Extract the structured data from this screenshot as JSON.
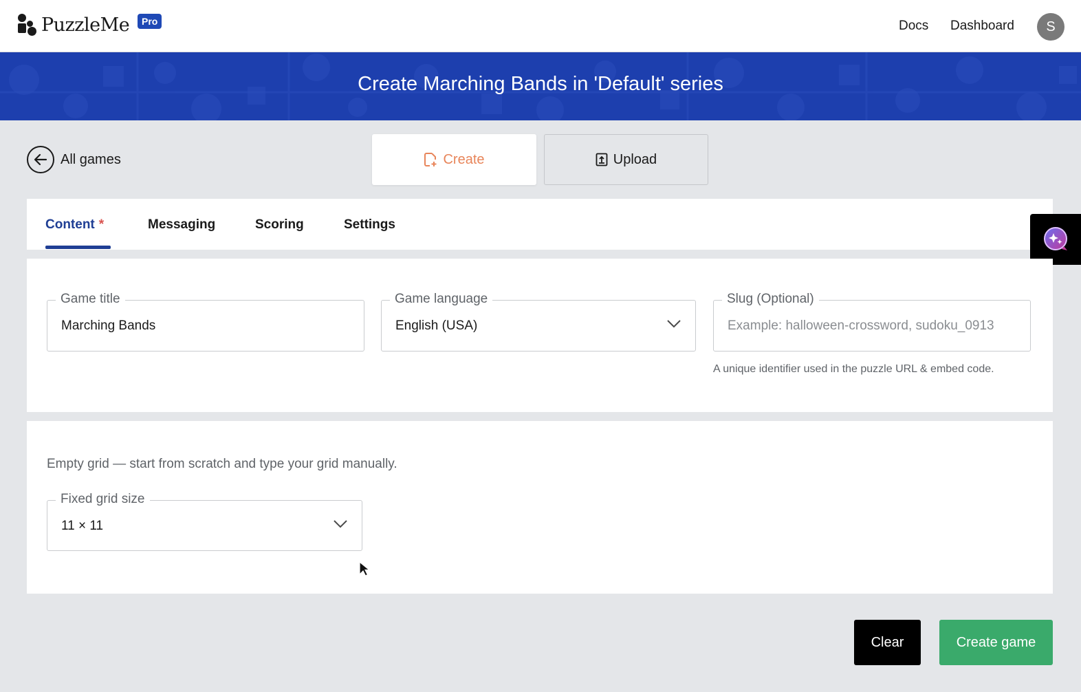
{
  "header": {
    "brand": "PuzzleMe",
    "badge": "Pro",
    "nav": [
      "Docs",
      "Dashboard"
    ],
    "avatar_initial": "S"
  },
  "banner": {
    "title": "Create Marching Bands in 'Default' series",
    "color": "#1d3fae"
  },
  "back": {
    "label": "All games",
    "icon": "arrow-left-icon"
  },
  "mode": {
    "create_label": "Create",
    "upload_label": "Upload",
    "active": "Create"
  },
  "tabs": [
    {
      "label": "Content",
      "required_mark": "*",
      "active": true
    },
    {
      "label": "Messaging"
    },
    {
      "label": "Scoring"
    },
    {
      "label": "Settings"
    }
  ],
  "form": {
    "game_title": {
      "label": "Game title",
      "value": "Marching Bands"
    },
    "game_language": {
      "label": "Game language",
      "value": "English (USA)"
    },
    "slug": {
      "label": "Slug (Optional)",
      "placeholder": "Example: halloween-crossword, sudoku_0913",
      "helper": "A unique identifier used in the puzzle URL & embed code."
    }
  },
  "grid": {
    "description": "Empty grid — start from scratch and type your grid manually.",
    "fixed_grid_size": {
      "label": "Fixed grid size",
      "value": "11 × 11"
    }
  },
  "actions": {
    "clear_label": "Clear",
    "create_label": "Create game"
  },
  "colors": {
    "accent": "#1f3e94",
    "create_accent": "#e8855a",
    "primary_green": "#3aaa6b"
  }
}
